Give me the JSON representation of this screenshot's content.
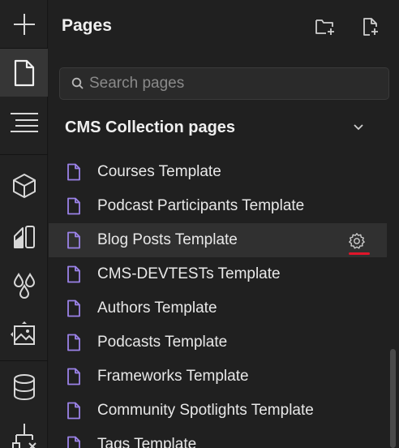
{
  "rail": {
    "items": [
      {
        "icon": "plus-icon"
      },
      {
        "icon": "page-icon",
        "active": true
      },
      {
        "icon": "navigator-icon"
      },
      {
        "icon": "components-icon"
      },
      {
        "icon": "style-manager-icon"
      },
      {
        "icon": "variables-icon"
      },
      {
        "icon": "assets-icon"
      },
      {
        "icon": "cms-icon"
      },
      {
        "icon": "logic-icon"
      }
    ]
  },
  "panel": {
    "title": "Pages",
    "actions": [
      {
        "icon": "new-folder-icon"
      },
      {
        "icon": "new-page-icon"
      }
    ]
  },
  "search": {
    "placeholder": "Search pages",
    "value": ""
  },
  "section": {
    "title": "CMS Collection pages",
    "expanded": true
  },
  "pages": [
    {
      "label": "Courses Template"
    },
    {
      "label": "Podcast Participants Template"
    },
    {
      "label": "Blog Posts Template",
      "hovered": true
    },
    {
      "label": "CMS-DEVTESTs Template"
    },
    {
      "label": "Authors Template"
    },
    {
      "label": "Podcasts Template"
    },
    {
      "label": "Frameworks Template"
    },
    {
      "label": "Community Spotlights Template"
    },
    {
      "label": "Tags Template"
    }
  ],
  "colors": {
    "page_icon": "#9b82e8",
    "highlight_underline": "#e0152a",
    "rail_active": "#363636",
    "hover_row": "#303030"
  }
}
